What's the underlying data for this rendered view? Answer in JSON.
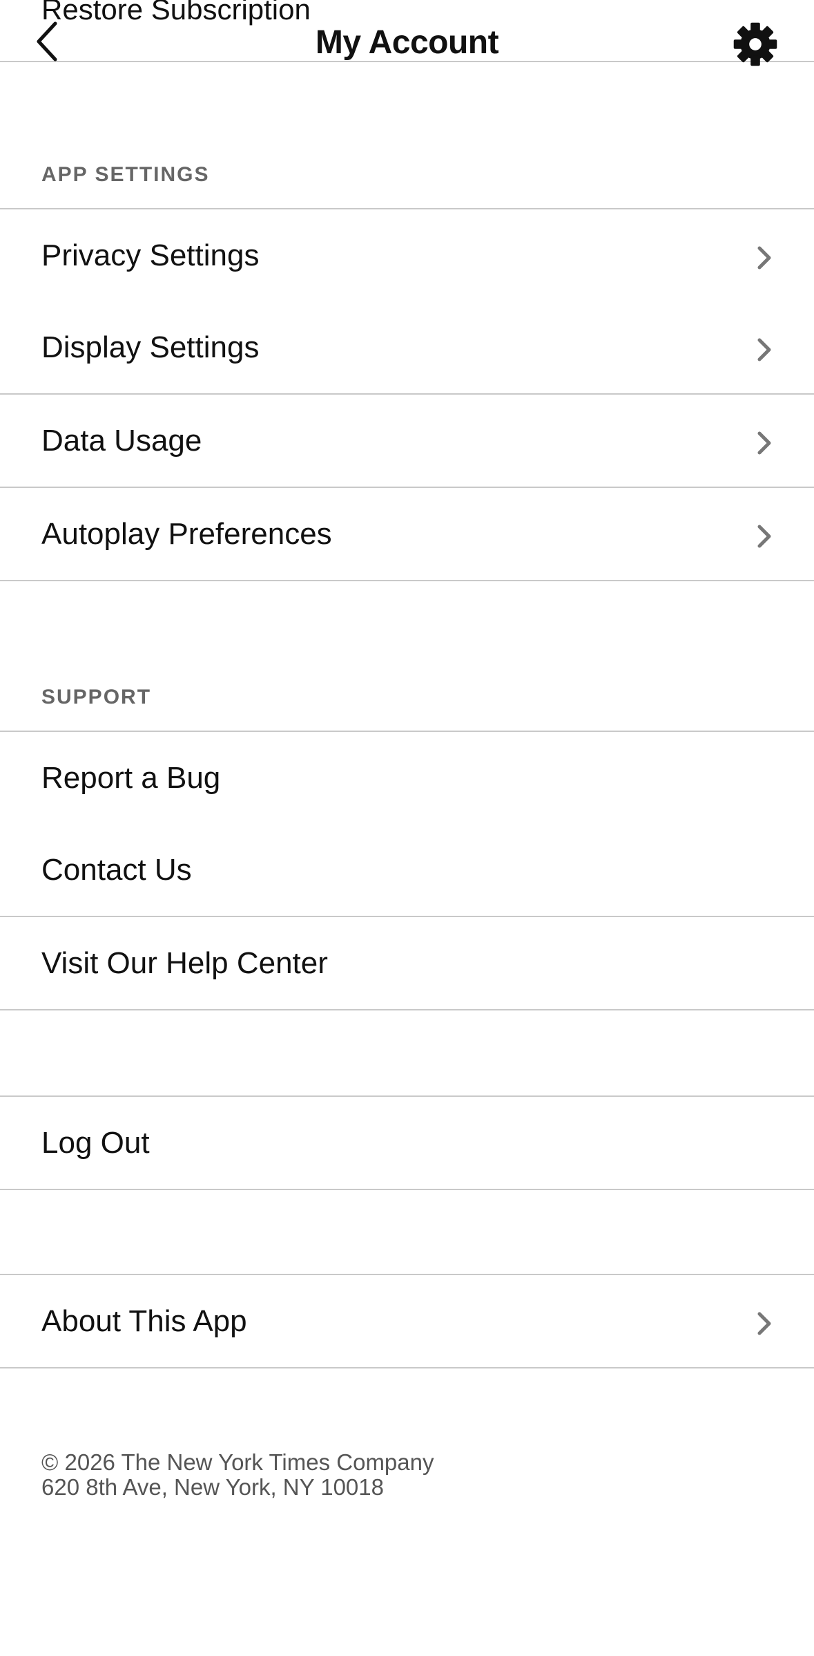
{
  "header": {
    "restore_label": "Restore Subscription",
    "title": "My Account",
    "back_icon": "chevron-left-icon",
    "settings_icon": "gear-icon"
  },
  "app_settings": {
    "heading": "APP SETTINGS",
    "items": [
      {
        "label": "Privacy Settings"
      },
      {
        "label": "Display Settings"
      },
      {
        "label": "Data Usage"
      },
      {
        "label": "Autoplay Preferences"
      }
    ]
  },
  "support": {
    "heading": "SUPPORT",
    "items": [
      {
        "label": "Report a Bug"
      },
      {
        "label": "Contact Us"
      },
      {
        "label": "Visit Our Help Center"
      }
    ]
  },
  "logout": {
    "label": "Log Out"
  },
  "about": {
    "label": "About This App"
  },
  "footer": {
    "copyright": "© 2026 The New York Times Company",
    "address": "620 8th Ave, New York, NY 10018"
  }
}
